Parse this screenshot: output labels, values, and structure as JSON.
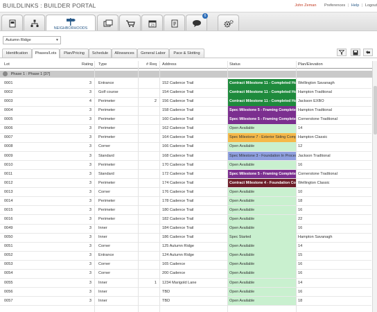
{
  "app": {
    "title": "BUILDLINKS : BUILDER PORTAL"
  },
  "toplinks": {
    "user": "John Zeman",
    "preferences": "Preferences",
    "help": "Help",
    "logout": "Logout",
    "sep": "|"
  },
  "nav": {
    "active_label": "NEIGHBORHOODS",
    "messages_badge": "6"
  },
  "filter": {
    "community": "Autumn Ridge",
    "arrow": "▼"
  },
  "subtabs": [
    "Identification",
    "Phases/Lots",
    "Plan/Pricing",
    "Schedule",
    "Allowances",
    "General Labor",
    "Pace & Slotting"
  ],
  "columns": {
    "lot": "Lot",
    "rating": "Rating",
    "type": "Type",
    "req": "# Req",
    "address": "Address",
    "status": "Status",
    "plan": "Plan/Elevation"
  },
  "phase": {
    "label": "Phase 1 : Phase 1 [37]"
  },
  "colors": {
    "green": "#1e8a3c",
    "purple": "#7b2f8f",
    "orange": "#f5b94a",
    "blue": "#8fa0e0",
    "maroon": "#6e1f2a",
    "openbg": "#c9f0cf"
  },
  "rows": [
    {
      "lot": "0001",
      "rating": "3",
      "type": "Entrance",
      "req": "",
      "address": "152 Cadence Trail",
      "status": "Contract Milestone 11 - Completed House",
      "kind": "green",
      "plan": "Wellington  Savanagh"
    },
    {
      "lot": "0002",
      "rating": "3",
      "type": "Golf course",
      "req": "",
      "address": "154 Cadence Trail",
      "status": "Contract Milestone 11 - Completed House",
      "kind": "green",
      "plan": "Hampton  Tradtional"
    },
    {
      "lot": "0003",
      "rating": "4",
      "type": "Perimeter",
      "req": "2",
      "address": "156 Cadence Trail",
      "status": "Contract Milestone 11 - Completed House",
      "kind": "green",
      "plan": "Jackson  EXBO"
    },
    {
      "lot": "0004",
      "rating": "3",
      "type": "Perimeter",
      "req": "",
      "address": "158 Cadence Trail",
      "status": "Spec Milestone 5 - Framing Complete",
      "kind": "purple",
      "plan": "Hampton  Tradtional"
    },
    {
      "lot": "0005",
      "rating": "3",
      "type": "Perimeter",
      "req": "",
      "address": "160 Cadence Trail",
      "status": "Spec Milestone 5 - Framing Complete",
      "kind": "purple",
      "plan": "Cornerstone  Tradtional"
    },
    {
      "lot": "0006",
      "rating": "3",
      "type": "Perimeter",
      "req": "",
      "address": "162 Cadence Trail",
      "status": "Open Available",
      "kind": "open",
      "plan": "14"
    },
    {
      "lot": "0007",
      "rating": "3",
      "type": "Perimeter",
      "req": "",
      "address": "164 Cadence Trail",
      "status": "Spec Milestone 7 - Exterior Siding Complete",
      "kind": "orange",
      "plan": "Hampton  Classic"
    },
    {
      "lot": "0008",
      "rating": "3",
      "type": "Corner",
      "req": "",
      "address": "166 Cadence Trail",
      "status": "Open Available",
      "kind": "open",
      "plan": "12"
    },
    {
      "lot": "0009",
      "rating": "3",
      "type": "Standard",
      "req": "",
      "address": "168 Cadence Trail",
      "status": "Spec Milestone 3 - Foundation In Process",
      "kind": "blue",
      "plan": "Jackson  Tradtional"
    },
    {
      "lot": "0010",
      "rating": "3",
      "type": "Perimeter",
      "req": "",
      "address": "170 Cadence Trail",
      "status": "Open Available",
      "kind": "open",
      "plan": "16"
    },
    {
      "lot": "0011",
      "rating": "3",
      "type": "Standard",
      "req": "",
      "address": "172 Cadence Trail",
      "status": "Spec Milestone 5 - Framing Complete",
      "kind": "purple",
      "plan": "Cornerstone  Tradtional"
    },
    {
      "lot": "0012",
      "rating": "3",
      "type": "Perimeter",
      "req": "",
      "address": "174 Cadence Trail",
      "status": "Contract Milestone 4 - Foundation Complete",
      "kind": "maroon",
      "plan": "Wellington  Classic"
    },
    {
      "lot": "0013",
      "rating": "3",
      "type": "Corner",
      "req": "",
      "address": "176 Cadence Trail",
      "status": "Open Available",
      "kind": "open",
      "plan": "10"
    },
    {
      "lot": "0014",
      "rating": "3",
      "type": "Perimeter",
      "req": "",
      "address": "178 Cadence Trail",
      "status": "Open Available",
      "kind": "open",
      "plan": "18"
    },
    {
      "lot": "0015",
      "rating": "3",
      "type": "Perimeter",
      "req": "",
      "address": "180 Cadence Trail",
      "status": "Open Available",
      "kind": "open",
      "plan": "16"
    },
    {
      "lot": "0016",
      "rating": "3",
      "type": "Perimeter",
      "req": "",
      "address": "182 Cadence Trail",
      "status": "Open Available",
      "kind": "open",
      "plan": "22"
    },
    {
      "lot": "0049",
      "rating": "3",
      "type": "Inner",
      "req": "",
      "address": "184 Cadence Trail",
      "status": "Open Available",
      "kind": "open",
      "plan": "16"
    },
    {
      "lot": "0050",
      "rating": "3",
      "type": "Inner",
      "req": "",
      "address": "186 Cadence Trail",
      "status": "Spec Started",
      "kind": "open",
      "plan": "Hampton  Savanagh"
    },
    {
      "lot": "0051",
      "rating": "3",
      "type": "Corner",
      "req": "",
      "address": "125 Autumn Ridge",
      "status": "Open Available",
      "kind": "open",
      "plan": "14"
    },
    {
      "lot": "0052",
      "rating": "3",
      "type": "Entrance",
      "req": "",
      "address": "124 Autumn Ridge",
      "status": "Open Available",
      "kind": "open",
      "plan": "15"
    },
    {
      "lot": "0053",
      "rating": "3",
      "type": "Corner",
      "req": "",
      "address": "165 Cadence",
      "status": "Open Available",
      "kind": "open",
      "plan": "16"
    },
    {
      "lot": "0054",
      "rating": "3",
      "type": "Corner",
      "req": "",
      "address": "200 Cadence",
      "status": "Open Available",
      "kind": "open",
      "plan": "16"
    },
    {
      "lot": "0055",
      "rating": "3",
      "type": "Inner",
      "req": "1",
      "address": "1234 Marigold Lane",
      "status": "Open Available",
      "kind": "open",
      "plan": "14"
    },
    {
      "lot": "0056",
      "rating": "3",
      "type": "Inner",
      "req": "",
      "address": "TBD",
      "status": "Open Available",
      "kind": "open",
      "plan": "16"
    },
    {
      "lot": "0057",
      "rating": "3",
      "type": "Inner",
      "req": "",
      "address": "TBD",
      "status": "Open Available",
      "kind": "open",
      "plan": "18"
    }
  ]
}
